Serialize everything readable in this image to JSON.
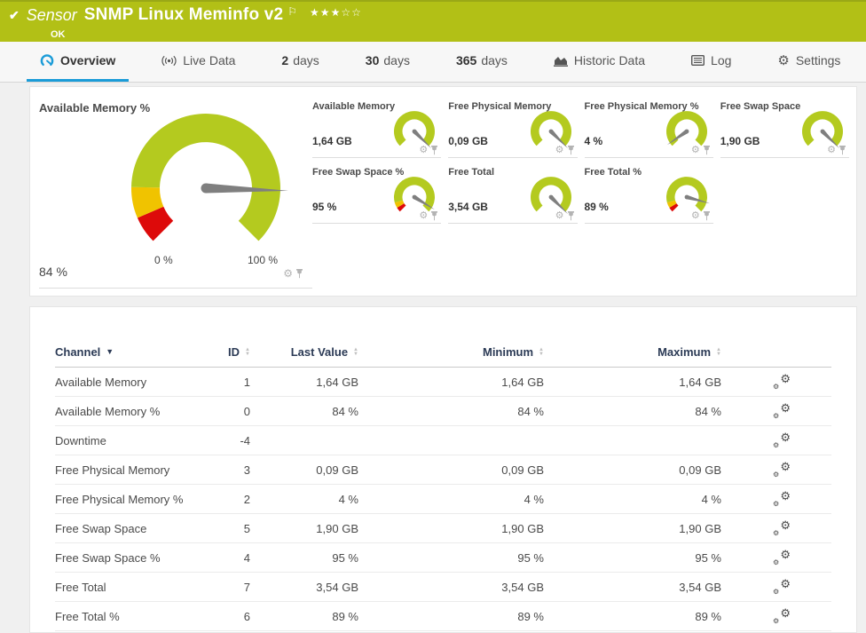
{
  "header": {
    "check": "✔",
    "kicker": "Sensor",
    "title": "SNMP Linux Meminfo v2",
    "flag": "⚐",
    "rating_filled": "★★★",
    "rating_empty": "☆☆",
    "status": "OK"
  },
  "tabs": [
    {
      "icon": "gauge-icon",
      "label": "Overview",
      "active": true
    },
    {
      "icon": "broadcast-icon",
      "label": "Live Data"
    },
    {
      "prefix": "2",
      "label": "days"
    },
    {
      "prefix": "30",
      "label": "days"
    },
    {
      "prefix": "365",
      "label": "days"
    },
    {
      "icon": "area-chart-icon",
      "label": "Historic Data"
    },
    {
      "icon": "log-icon",
      "label": "Log"
    },
    {
      "icon": "gear-icon",
      "label": "Settings"
    }
  ],
  "colors": {
    "brand_green": "#b2c016",
    "gauge_green": "#b4ca1f",
    "gauge_yellow": "#f0c300",
    "gauge_red": "#dd0a0a",
    "accent_blue": "#1b9cd8",
    "navy": "#2b3a55",
    "needle_grey": "#7f7f7f"
  },
  "icons": {
    "gear_glyph": "⚙",
    "pin_name": "pin-icon",
    "channel_edit_name": "channel-gear-icon"
  },
  "overview": {
    "big_gauge": {
      "title": "Available Memory %",
      "value": "84 %",
      "fraction": 0.84,
      "min_label": "0 %",
      "max_label": "100 %",
      "segments": [
        {
          "from": 0,
          "to": 0.08,
          "color_key": "gauge_red"
        },
        {
          "from": 0.08,
          "to": 0.17,
          "color_key": "gauge_yellow"
        },
        {
          "from": 0.17,
          "to": 1,
          "color_key": "gauge_green"
        }
      ]
    },
    "small_gauges": [
      {
        "title": "Available Memory",
        "value": "1,64 GB",
        "fraction": 1,
        "segments": [
          {
            "from": 0,
            "to": 1,
            "color_key": "gauge_green"
          }
        ]
      },
      {
        "title": "Free Physical Memory",
        "value": "0,09 GB",
        "fraction": 1,
        "segments": [
          {
            "from": 0,
            "to": 1,
            "color_key": "gauge_green"
          }
        ]
      },
      {
        "title": "Free Physical Memory %",
        "value": "4 %",
        "fraction": 0.04,
        "segments": [
          {
            "from": 0,
            "to": 1,
            "color_key": "gauge_green"
          }
        ]
      },
      {
        "title": "Free Swap Space",
        "value": "1,90 GB",
        "fraction": 1,
        "segments": [
          {
            "from": 0,
            "to": 1,
            "color_key": "gauge_green"
          }
        ]
      },
      {
        "title": "Free Swap Space %",
        "value": "95 %",
        "fraction": 0.95,
        "segments": [
          {
            "from": 0,
            "to": 0.05,
            "color_key": "gauge_red"
          },
          {
            "from": 0.05,
            "to": 0.11,
            "color_key": "gauge_yellow"
          },
          {
            "from": 0.11,
            "to": 1,
            "color_key": "gauge_green"
          }
        ]
      },
      {
        "title": "Free Total",
        "value": "3,54 GB",
        "fraction": 1,
        "segments": [
          {
            "from": 0,
            "to": 1,
            "color_key": "gauge_green"
          }
        ]
      },
      {
        "title": "Free Total %",
        "value": "89 %",
        "fraction": 0.89,
        "segments": [
          {
            "from": 0,
            "to": 0.05,
            "color_key": "gauge_red"
          },
          {
            "from": 0.05,
            "to": 0.11,
            "color_key": "gauge_yellow"
          },
          {
            "from": 0.11,
            "to": 1,
            "color_key": "gauge_green"
          }
        ]
      }
    ]
  },
  "table": {
    "columns": [
      {
        "label": "Channel",
        "sort": "active-desc"
      },
      {
        "label": "ID"
      },
      {
        "label": "Last Value"
      },
      {
        "label": "Minimum"
      },
      {
        "label": "Maximum"
      }
    ],
    "rows": [
      {
        "channel": "Available Memory",
        "id": "1",
        "last": "1,64 GB",
        "min": "1,64 GB",
        "max": "1,64 GB"
      },
      {
        "channel": "Available Memory %",
        "id": "0",
        "last": "84 %",
        "min": "84 %",
        "max": "84 %"
      },
      {
        "channel": "Downtime",
        "id": "-4",
        "last": "",
        "min": "",
        "max": ""
      },
      {
        "channel": "Free Physical Memory",
        "id": "3",
        "last": "0,09 GB",
        "min": "0,09 GB",
        "max": "0,09 GB"
      },
      {
        "channel": "Free Physical Memory %",
        "id": "2",
        "last": "4 %",
        "min": "4 %",
        "max": "4 %"
      },
      {
        "channel": "Free Swap Space",
        "id": "5",
        "last": "1,90 GB",
        "min": "1,90 GB",
        "max": "1,90 GB"
      },
      {
        "channel": "Free Swap Space %",
        "id": "4",
        "last": "95 %",
        "min": "95 %",
        "max": "95 %"
      },
      {
        "channel": "Free Total",
        "id": "7",
        "last": "3,54 GB",
        "min": "3,54 GB",
        "max": "3,54 GB"
      },
      {
        "channel": "Free Total %",
        "id": "6",
        "last": "89 %",
        "min": "89 %",
        "max": "89 %"
      }
    ]
  }
}
